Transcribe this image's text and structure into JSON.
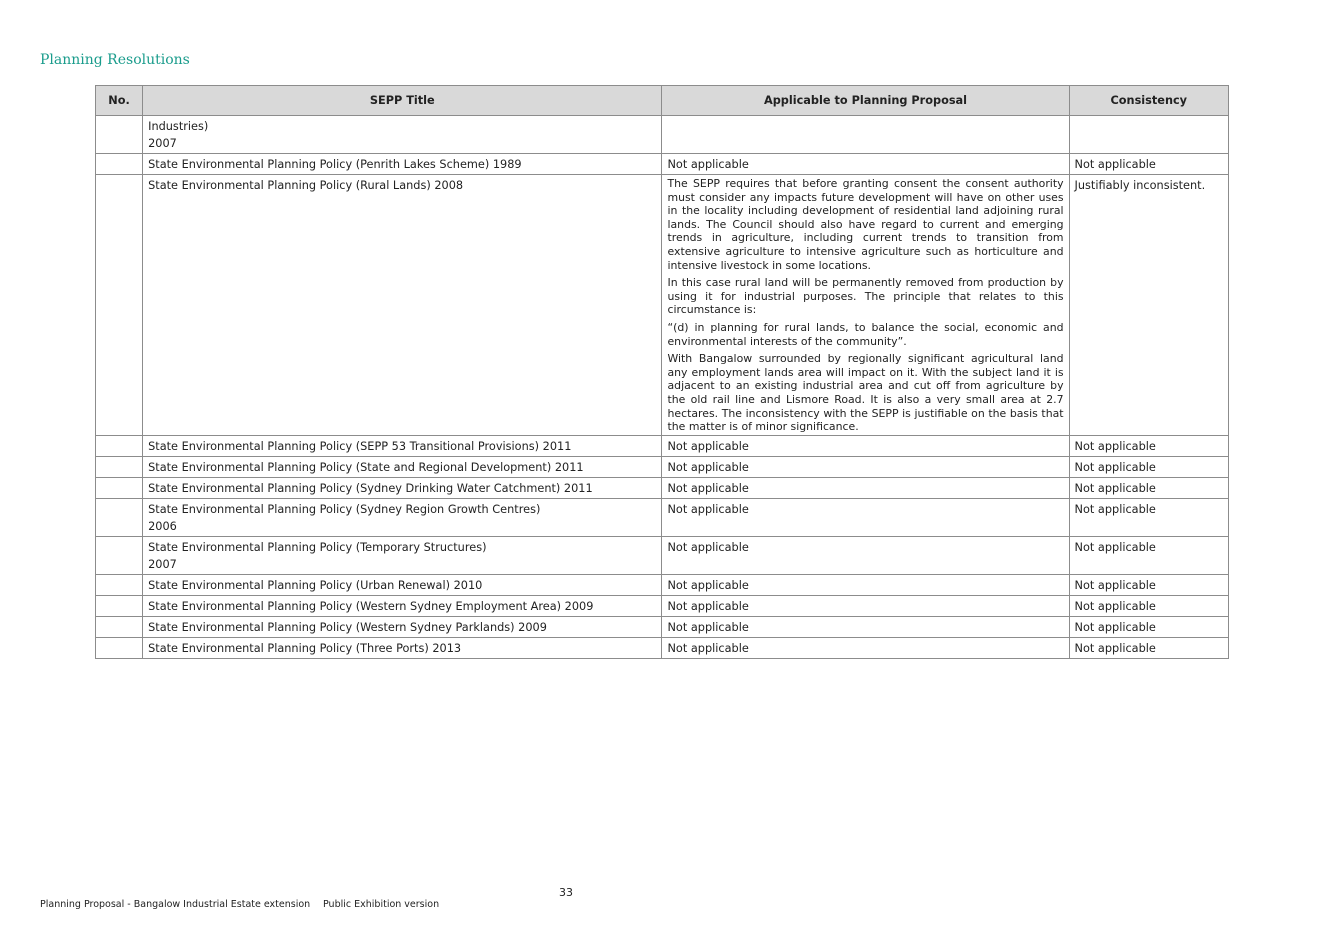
{
  "header": {
    "title": "Planning Resolutions"
  },
  "table": {
    "columns": [
      "No.",
      "SEPP Title",
      "Applicable to Planning Proposal",
      "Consistency"
    ],
    "rows": [
      {
        "no": "",
        "title": "Industries)\n2007",
        "applicable": [
          ""
        ],
        "consistency": ""
      },
      {
        "no": "",
        "title": "State Environmental Planning Policy (Penrith Lakes Scheme) 1989",
        "applicable": [
          "Not applicable"
        ],
        "consistency": "Not applicable"
      },
      {
        "no": "",
        "title": "State Environmental Planning Policy (Rural Lands) 2008",
        "applicable": [
          "The SEPP requires that before granting consent the consent authority must consider any impacts future development will have on other uses in the locality including development of residential land adjoining rural lands.  The Council should also have regard to current and emerging trends in agriculture, including current trends to transition from extensive agriculture to intensive agriculture such as horticulture and intensive livestock in some locations.",
          "In this case rural land will be permanently removed from production by using it for industrial purposes. The principle that relates to this circumstance is:",
          "“(d) in planning for rural lands, to balance the social, economic and environmental interests of the community”.",
          "With Bangalow surrounded by regionally significant agricultural land any employment lands area will impact on it. With the subject land it is adjacent to an existing industrial area and cut off from agriculture by the old rail line and Lismore Road. It is also a very small area at 2.7 hectares. The inconsistency with the SEPP is justifiable on the basis that the matter is of minor significance."
        ],
        "consistency": "Justifiably inconsistent."
      },
      {
        "no": "",
        "title": "State Environmental Planning Policy (SEPP 53 Transitional Provisions) 2011",
        "applicable": [
          "Not applicable"
        ],
        "consistency": "Not applicable"
      },
      {
        "no": "",
        "title": "State Environmental Planning Policy (State and Regional Development) 2011",
        "applicable": [
          "Not applicable"
        ],
        "consistency": "Not applicable"
      },
      {
        "no": "",
        "title": "State Environmental Planning Policy (Sydney Drinking Water Catchment) 2011",
        "applicable": [
          "Not applicable"
        ],
        "consistency": "Not applicable"
      },
      {
        "no": "",
        "title": "State Environmental Planning Policy (Sydney Region Growth Centres)\n2006",
        "applicable": [
          "Not applicable"
        ],
        "consistency": "Not applicable"
      },
      {
        "no": "",
        "title": "State Environmental Planning Policy (Temporary Structures)\n2007",
        "applicable": [
          "Not applicable"
        ],
        "consistency": "Not applicable"
      },
      {
        "no": "",
        "title": "State Environmental Planning Policy (Urban Renewal) 2010",
        "applicable": [
          "Not applicable"
        ],
        "consistency": "Not applicable"
      },
      {
        "no": "",
        "title": "State Environmental Planning Policy (Western Sydney Employment Area) 2009",
        "applicable": [
          "Not applicable"
        ],
        "consistency": "Not applicable"
      },
      {
        "no": "",
        "title": "State Environmental Planning Policy (Western Sydney Parklands) 2009",
        "applicable": [
          "Not applicable"
        ],
        "consistency": "Not applicable"
      },
      {
        "no": "",
        "title": "State Environmental Planning Policy (Three Ports) 2013",
        "applicable": [
          "Not applicable"
        ],
        "consistency": "Not applicable"
      }
    ]
  },
  "footer": {
    "page_number": "33",
    "document": "Planning Proposal - Bangalow Industrial Estate extension",
    "version": "Public Exhibition version"
  }
}
